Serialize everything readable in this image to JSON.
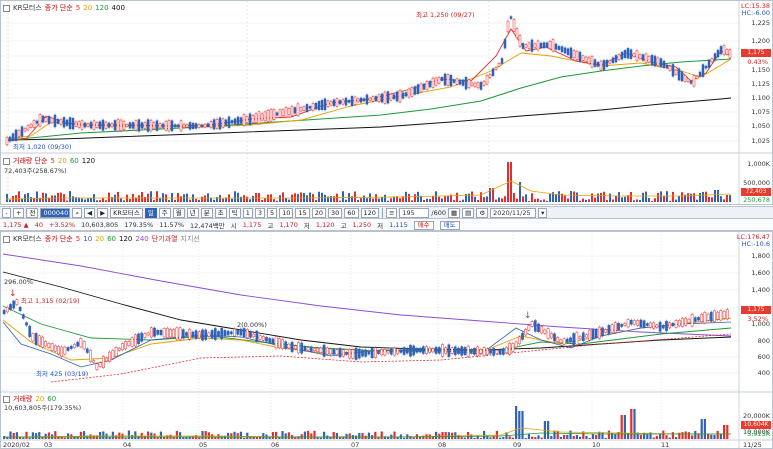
{
  "top_chart": {
    "stock_name": "KR모터스",
    "legend": [
      "종가 단순",
      "5",
      "20",
      "120",
      "400"
    ],
    "legend_colors": [
      "#333333",
      "#e62d2d",
      "#e6a100",
      "#1d9a3a",
      "#111111"
    ],
    "high_note": "최고 1,250 (09/27)",
    "low_note": "최저 1,020 (09/30)",
    "y_labels": [
      "1,225",
      "1,200",
      "1,175",
      "1,150",
      "1,125",
      "1,100",
      "1,075",
      "1,050",
      "1,025"
    ],
    "lc_label": "LC:15.38",
    "hc_label": "HC:-6.00",
    "price_tag": "1,175",
    "pct_tag": "0.43%",
    "volume_legend": [
      "거래량 단순",
      "5",
      "20",
      "60",
      "120"
    ],
    "volume_value": "72,403주(258.67%)",
    "volume_y_labels": [
      "1,000K",
      "500,000"
    ],
    "volume_tag": "72,403",
    "volume_tag2": "250,678"
  },
  "toolbar": {
    "btn_minus": "-",
    "btn_plus": "+",
    "btn_all": "전",
    "code_input": "000040",
    "stock_name": "KR모터스",
    "period_day": "일",
    "period_week": "주",
    "period_month": "월",
    "period_year": "년",
    "period_min": "분",
    "period_tick": "초",
    "period_t": "틱",
    "minutes": [
      "1",
      "3",
      "5",
      "10",
      "15",
      "20",
      "30",
      "60",
      "120"
    ],
    "count": "195",
    "count_total": "/600",
    "date": "2020/11/25"
  },
  "info_bar": {
    "price": "1,175",
    "change": "40",
    "change_pct": "+3.52%",
    "volume": "10,603,805",
    "volume_pct": "179.35%",
    "turnover": "11.57%",
    "amount": "12,474백만",
    "label_start": "시",
    "start": "1,175",
    "label_high": "고",
    "high": "1,170",
    "label_low": "저",
    "low": "1,120",
    "label_close": "고",
    "close_val": "1,250",
    "label_low2": "저",
    "low2": "1,115",
    "buy": "매수",
    "sell": "매도",
    "price_label": "1,175 ▲"
  },
  "bottom_chart": {
    "stock_name": "KR모터스",
    "legend": [
      "종가 단순",
      "5",
      "10",
      "20",
      "60",
      "120",
      "240"
    ],
    "legend_extra": "단기과열",
    "legend_extra2": "지지선",
    "legend_colors": [
      "#333333",
      "#e62d2d",
      "#2f62b8",
      "#e6a100",
      "#1d9a3a",
      "#111111",
      "#8b4bd6"
    ],
    "high_note": "최고 1,315 (02/19)",
    "low_note": "최저 425 (03/19)",
    "pct_note": "296.00%",
    "mid_note": "2(0.00%)",
    "y_labels": [
      "1,800",
      "1,600",
      "1,400",
      "1,200",
      "1,000",
      "800",
      "600",
      "400"
    ],
    "lc_label": "LC:176.47",
    "hc_label": "HC:-10.6",
    "price_tag": "1,175",
    "pct_tag": "3.52%",
    "volume_legend": [
      "거래량",
      "20",
      "60"
    ],
    "volume_value": "10,603,805주(179.35%)",
    "volume_y_labels": [
      "20,000K",
      "10,000K"
    ],
    "volume_tag": "10,604K",
    "volume_tag2": "5,913K",
    "x_labels": [
      "2020/02",
      "03",
      "04",
      "05",
      "06",
      "07",
      "08",
      "09",
      "10",
      "11",
      "11/25"
    ]
  }
}
